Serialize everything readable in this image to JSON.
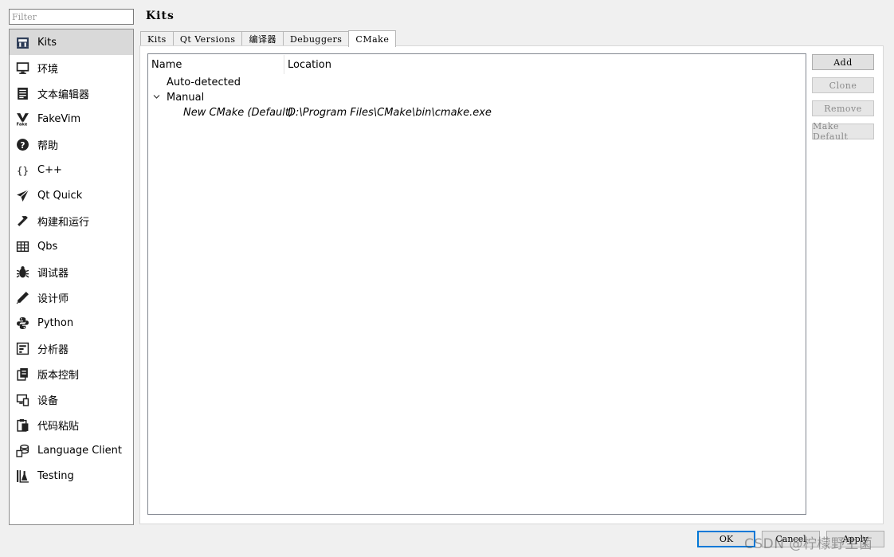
{
  "filter": {
    "placeholder": "Filter",
    "value": ""
  },
  "sidebar": {
    "items": [
      {
        "label": "Kits",
        "icon": "kits-icon",
        "selected": true
      },
      {
        "label": "环境",
        "icon": "monitor-icon"
      },
      {
        "label": "文本编辑器",
        "icon": "text-editor-icon"
      },
      {
        "label": "FakeVim",
        "icon": "fakevim-icon"
      },
      {
        "label": "帮助",
        "icon": "help-icon"
      },
      {
        "label": "C++",
        "icon": "braces-icon"
      },
      {
        "label": "Qt Quick",
        "icon": "paper-plane-icon"
      },
      {
        "label": "构建和运行",
        "icon": "hammer-icon"
      },
      {
        "label": "Qbs",
        "icon": "grid-icon"
      },
      {
        "label": "调试器",
        "icon": "bug-icon"
      },
      {
        "label": "设计师",
        "icon": "pencil-icon"
      },
      {
        "label": "Python",
        "icon": "python-icon"
      },
      {
        "label": "分析器",
        "icon": "analyzer-icon"
      },
      {
        "label": "版本控制",
        "icon": "version-control-icon"
      },
      {
        "label": "设备",
        "icon": "device-icon"
      },
      {
        "label": "代码粘贴",
        "icon": "clipboard-icon"
      },
      {
        "label": "Language Client",
        "icon": "language-client-icon"
      },
      {
        "label": "Testing",
        "icon": "testing-icon"
      }
    ]
  },
  "page": {
    "title": "Kits"
  },
  "tabs": [
    {
      "label": "Kits",
      "active": false
    },
    {
      "label": "Qt Versions",
      "active": false
    },
    {
      "label": "编译器",
      "active": false
    },
    {
      "label": "Debuggers",
      "active": false
    },
    {
      "label": "CMake",
      "active": true
    }
  ],
  "tree": {
    "columns": {
      "name": "Name",
      "location": "Location"
    },
    "groups": [
      {
        "label": "Auto-detected",
        "expanded": false,
        "items": []
      },
      {
        "label": "Manual",
        "expanded": true,
        "items": [
          {
            "name": "New CMake (Default)",
            "location": "D:\\Program Files\\CMake\\bin\\cmake.exe"
          }
        ]
      }
    ]
  },
  "side_buttons": {
    "add": "Add",
    "clone": "Clone",
    "remove": "Remove",
    "make_default": "Make Default"
  },
  "dialog_buttons": {
    "ok": "OK",
    "cancel": "Cancel",
    "apply": "Apply"
  },
  "watermark": "CSDN @柠檬野生菌",
  "colors": {
    "selection": "#d9d9d9",
    "focus_border": "#0078d7",
    "window_bg": "#f0f0f0"
  }
}
